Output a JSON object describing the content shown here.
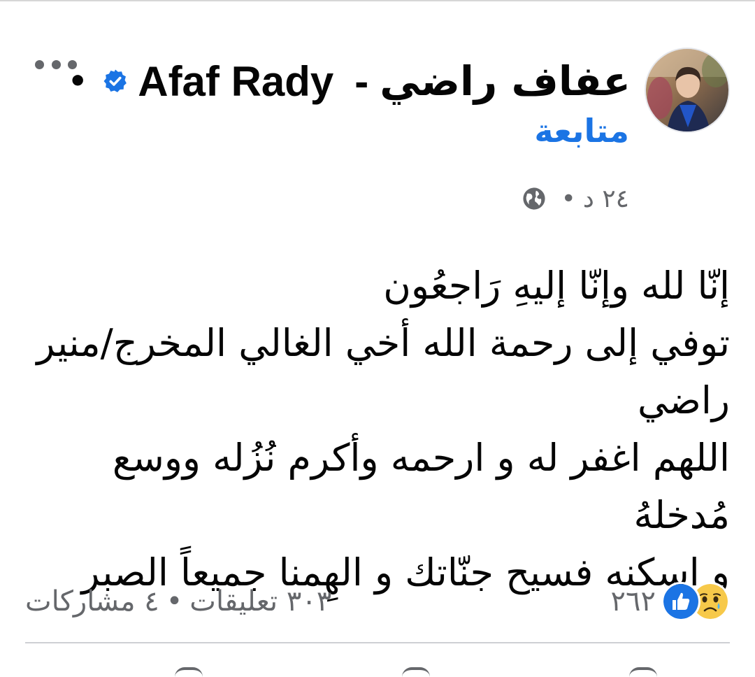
{
  "post": {
    "author_name_ar": "عفاف راضي",
    "author_separator": "-",
    "author_name_en": "Afaf Rady",
    "verified_icon": "verified-badge-icon",
    "dot": "•",
    "follow_label": "متابعة",
    "time": "٢٤ د",
    "meta_dot": "•",
    "privacy_icon": "globe-icon",
    "body_lines": [
      "إنّا لله وإنّا إليهِ رَاجعُون",
      "توفي إلى رحمة الله أخي الغالي المخرج/منير راضي",
      "اللهم اغفر له و ارحمه وأكرم نُزُله ووسع مُدخلهُ",
      "و اسكنه فسيح جنّاتك و الهِمنا جميعاً الصبر"
    ],
    "reactions": {
      "icons": [
        "sad-reaction-icon",
        "like-reaction-icon"
      ],
      "count": "٢٦٢"
    },
    "comments_label": "٣٠٣ تعليقات",
    "stats_separator": "•",
    "shares_label": "٤ مشاركات"
  },
  "colors": {
    "accent": "#1b74e4",
    "secondary_text": "#65676b",
    "primary_text": "#050505",
    "divider": "#ced0d4"
  }
}
